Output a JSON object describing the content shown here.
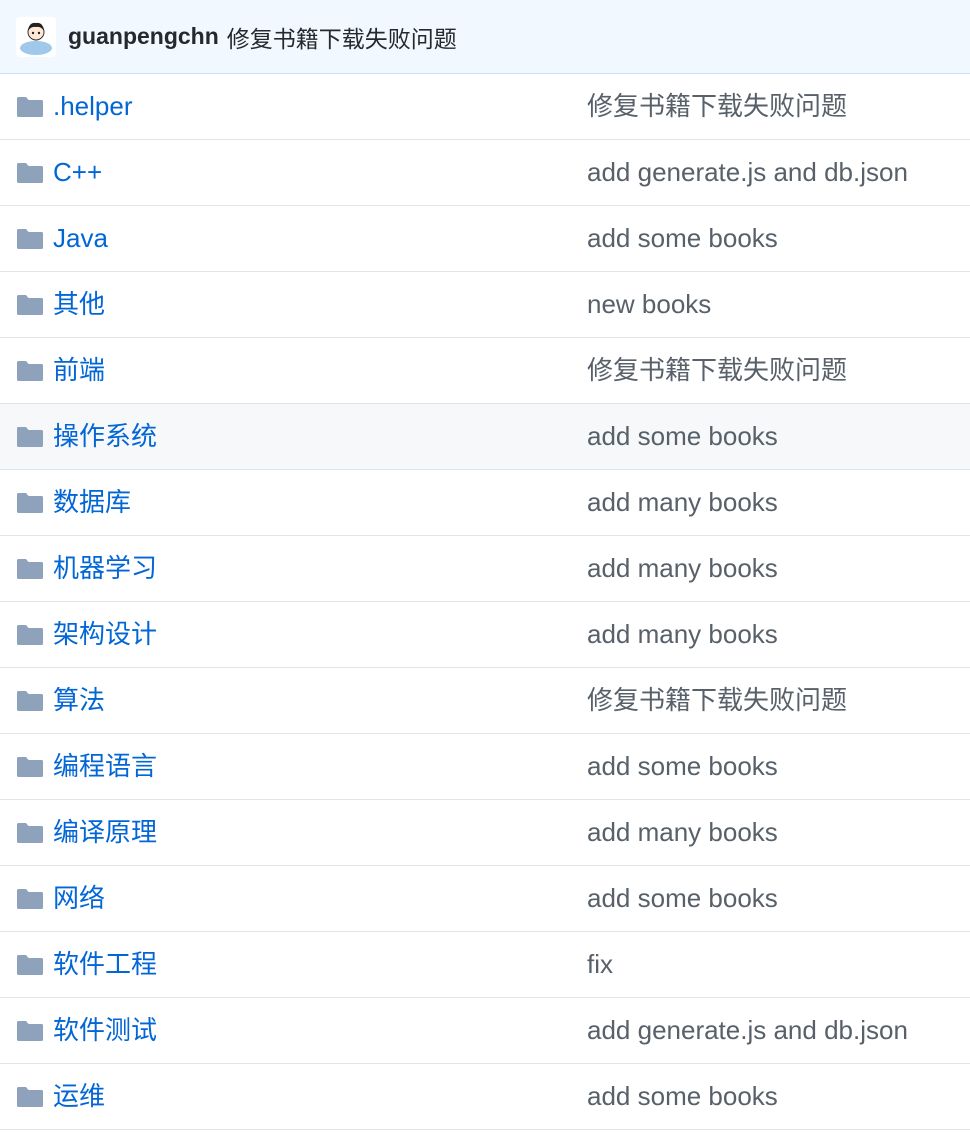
{
  "latest_commit": {
    "author": "guanpengchn",
    "message": "修复书籍下载失败问题"
  },
  "colors": {
    "link": "#0366d6",
    "muted": "#586069",
    "folder": "#79b8ff",
    "header_bg": "#f1f8ff"
  },
  "icons": {
    "avatar": "avatar-icon",
    "folder": "folder-icon"
  },
  "files": [
    {
      "name": ".helper",
      "commit": "修复书籍下载失败问题"
    },
    {
      "name": "C++",
      "commit": "add generate.js and db.json"
    },
    {
      "name": "Java",
      "commit": "add some books"
    },
    {
      "name": "其他",
      "commit": "new books"
    },
    {
      "name": "前端",
      "commit": "修复书籍下载失败问题"
    },
    {
      "name": "操作系统",
      "commit": "add some books"
    },
    {
      "name": "数据库",
      "commit": "add many books"
    },
    {
      "name": "机器学习",
      "commit": "add many books"
    },
    {
      "name": "架构设计",
      "commit": "add many books"
    },
    {
      "name": "算法",
      "commit": "修复书籍下载失败问题"
    },
    {
      "name": "编程语言",
      "commit": "add some books"
    },
    {
      "name": "编译原理",
      "commit": "add many books"
    },
    {
      "name": "网络",
      "commit": "add some books"
    },
    {
      "name": "软件工程",
      "commit": "fix"
    },
    {
      "name": "软件测试",
      "commit": "add generate.js and db.json"
    },
    {
      "name": "运维",
      "commit": "add some books"
    }
  ]
}
